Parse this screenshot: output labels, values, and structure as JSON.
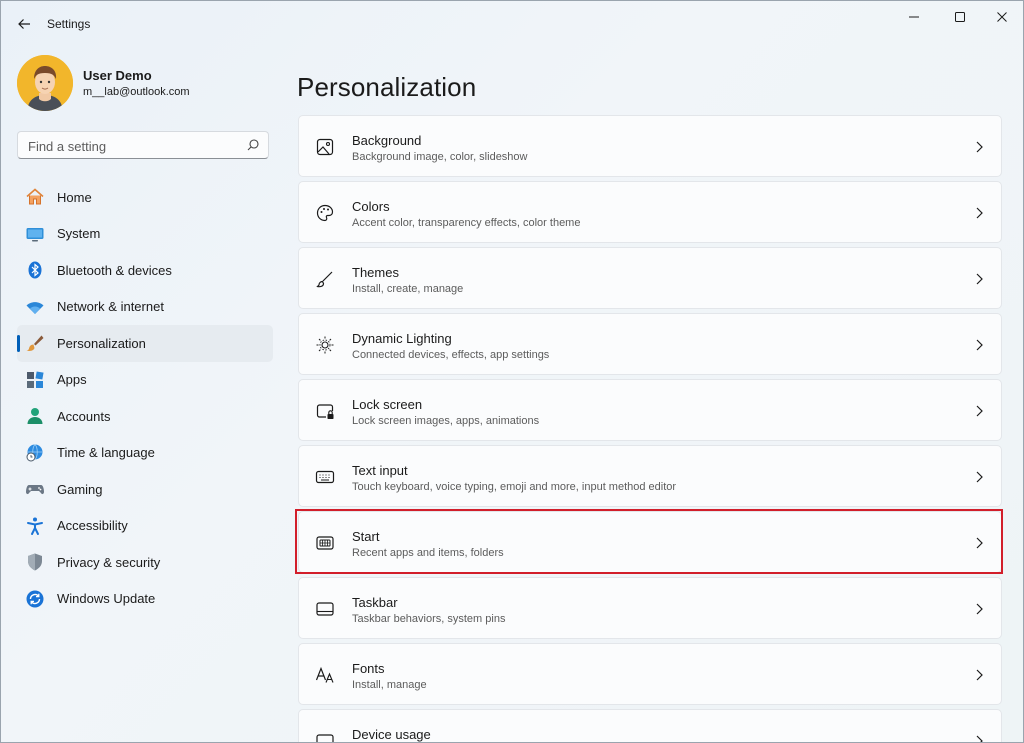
{
  "window": {
    "title": "Settings"
  },
  "user": {
    "name": "User Demo",
    "email": "m__lab@outlook.com"
  },
  "search": {
    "placeholder": "Find a setting"
  },
  "nav": {
    "items": [
      {
        "label": "Home",
        "icon": "home-icon"
      },
      {
        "label": "System",
        "icon": "monitor-icon"
      },
      {
        "label": "Bluetooth & devices",
        "icon": "bluetooth-icon"
      },
      {
        "label": "Network & internet",
        "icon": "wifi-icon"
      },
      {
        "label": "Personalization",
        "icon": "brush-icon",
        "selected": true
      },
      {
        "label": "Apps",
        "icon": "apps-icon"
      },
      {
        "label": "Accounts",
        "icon": "person-icon"
      },
      {
        "label": "Time & language",
        "icon": "globe-clock-icon"
      },
      {
        "label": "Gaming",
        "icon": "gamepad-icon"
      },
      {
        "label": "Accessibility",
        "icon": "accessibility-icon"
      },
      {
        "label": "Privacy & security",
        "icon": "shield-icon"
      },
      {
        "label": "Windows Update",
        "icon": "update-icon"
      }
    ]
  },
  "main": {
    "title": "Personalization",
    "cards": [
      {
        "title": "Background",
        "subtitle": "Background image, color, slideshow",
        "icon": "image-icon"
      },
      {
        "title": "Colors",
        "subtitle": "Accent color, transparency effects, color theme",
        "icon": "palette-icon"
      },
      {
        "title": "Themes",
        "subtitle": "Install, create, manage",
        "icon": "brush-icon"
      },
      {
        "title": "Dynamic Lighting",
        "subtitle": "Connected devices, effects, app settings",
        "icon": "lighting-icon"
      },
      {
        "title": "Lock screen",
        "subtitle": "Lock screen images, apps, animations",
        "icon": "lock-screen-icon"
      },
      {
        "title": "Text input",
        "subtitle": "Touch keyboard, voice typing, emoji and more, input method editor",
        "icon": "keyboard-icon"
      },
      {
        "title": "Start",
        "subtitle": "Recent apps and items, folders",
        "icon": "start-icon",
        "highlighted": true
      },
      {
        "title": "Taskbar",
        "subtitle": "Taskbar behaviors, system pins",
        "icon": "taskbar-icon"
      },
      {
        "title": "Fonts",
        "subtitle": "Install, manage",
        "icon": "font-icon"
      },
      {
        "title": "Device usage",
        "subtitle": "",
        "icon": "device-usage-icon"
      }
    ]
  },
  "colors": {
    "accent": "#005fb8",
    "highlight": "#d21e2a"
  }
}
